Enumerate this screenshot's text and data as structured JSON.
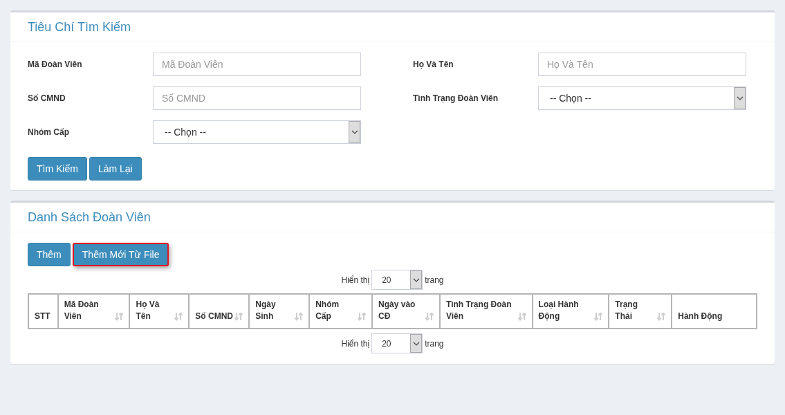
{
  "search_panel": {
    "title": "Tiêu Chí Tìm Kiếm",
    "fields": [
      {
        "kind": "text",
        "label": "Mã Đoàn Viên",
        "placeholder": "Mã Đoàn Viên"
      },
      {
        "kind": "text",
        "label": "Họ Và Tên",
        "placeholder": "Họ Và Tên"
      },
      {
        "kind": "text",
        "label": "Số CMND",
        "placeholder": "Số CMND"
      },
      {
        "kind": "select",
        "label": "Tình Trạng Đoàn Viên",
        "value": "-- Chọn --"
      },
      {
        "kind": "select",
        "label": "Nhóm Cấp",
        "value": "-- Chọn --"
      }
    ],
    "buttons": [
      {
        "label": "Tìm Kiếm",
        "highlighted": false
      },
      {
        "label": "Làm Lại",
        "highlighted": false
      }
    ]
  },
  "list_panel": {
    "title": "Danh Sách Đoàn Viên",
    "buttons": [
      {
        "label": "Thêm",
        "highlighted": false
      },
      {
        "label": "Thêm Mới Từ File",
        "highlighted": true
      }
    ],
    "page_size_top": {
      "prefix": "Hiển thị",
      "value": "20",
      "suffix": "trang"
    },
    "table": {
      "columns": [
        {
          "label": "STT",
          "sortable": false
        },
        {
          "label": "Mã Đoàn Viên",
          "sortable": true
        },
        {
          "label": "Họ Và Tên",
          "sortable": true
        },
        {
          "label": "Số CMND",
          "sortable": true
        },
        {
          "label": "Ngày Sinh",
          "sortable": true
        },
        {
          "label": "Nhóm Cấp",
          "sortable": true
        },
        {
          "label": "Ngày vào CĐ",
          "sortable": true
        },
        {
          "label": "Tình Trạng Đoàn Viên",
          "sortable": true
        },
        {
          "label": "Loại Hành Động",
          "sortable": true
        },
        {
          "label": "Trạng Thái",
          "sortable": true
        },
        {
          "label": "Hành Động",
          "sortable": false
        }
      ]
    },
    "page_size_bottom": {
      "prefix": "Hiển thị",
      "value": "20",
      "suffix": "trang"
    }
  }
}
